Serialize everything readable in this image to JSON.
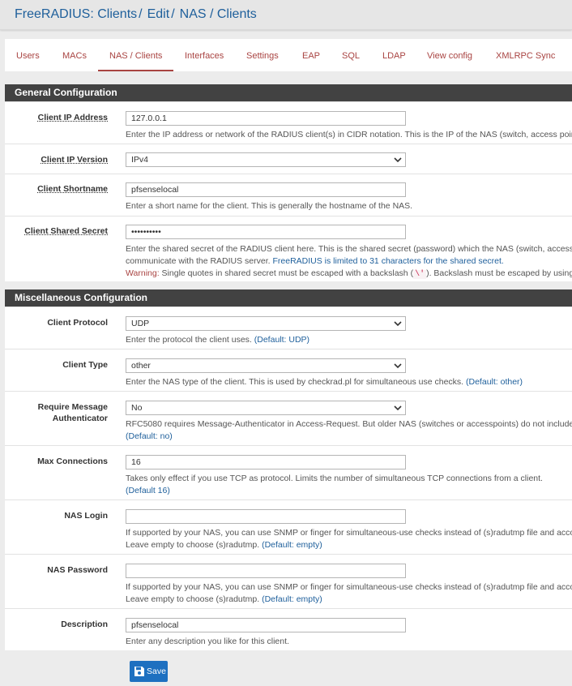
{
  "breadcrumb": {
    "part1": "FreeRADIUS: Clients",
    "part2": "Edit",
    "part3": "NAS / Clients",
    "sep": "/"
  },
  "tabs": [
    {
      "label": "Users"
    },
    {
      "label": "MACs"
    },
    {
      "label": "NAS / Clients",
      "active": true
    },
    {
      "label": "Interfaces"
    },
    {
      "label": "Settings"
    },
    {
      "label": "EAP"
    },
    {
      "label": "SQL"
    },
    {
      "label": "LDAP"
    },
    {
      "label": "View config"
    },
    {
      "label": "XMLRPC Sync"
    }
  ],
  "general": {
    "title": "General Configuration",
    "ip_address": {
      "label": "Client IP Address",
      "value": "127.0.0.1",
      "help": "Enter the IP address or network of the RADIUS client(s) in CIDR notation. This is the IP of the NAS (switch, access point"
    },
    "ip_version": {
      "label": "Client IP Version",
      "value": "IPv4"
    },
    "shortname": {
      "label": "Client Shortname",
      "value": "pfsenselocal",
      "help": "Enter a short name for the client. This is generally the hostname of the NAS."
    },
    "secret": {
      "label": "Client Shared Secret",
      "value": "••••••••••",
      "help1": "Enter the shared secret of the RADIUS client here. This is the shared secret (password) which the NAS (switch, accessp",
      "help2a": "communicate with the RADIUS server. ",
      "help2b": "FreeRADIUS is limited to 31 characters for the shared secret.",
      "warn_label": "Warning:",
      "warn_text": " Single quotes in shared secret must be escaped with a backslash (",
      "warn_code": "\\'",
      "warn_tail": "). Backslash must be escaped by using"
    }
  },
  "misc": {
    "title": "Miscellaneous Configuration",
    "protocol": {
      "label": "Client Protocol",
      "value": "UDP",
      "help": "Enter the protocol the client uses. ",
      "default": "(Default: UDP)"
    },
    "type": {
      "label": "Client Type",
      "value": "other",
      "help": "Enter the NAS type of the client. This is used by checkrad.pl for simultaneous use checks. ",
      "default": "(Default: other)"
    },
    "msg_auth": {
      "label_line1": "Require Message",
      "label_line2": "Authenticator",
      "value": "No",
      "help": "RFC5080 requires Message-Authenticator in Access-Request. But older NAS (switches or accesspoints) do not include",
      "default": "(Default: no)"
    },
    "max_conn": {
      "label": "Max Connections",
      "value": "16",
      "help": "Takes only effect if you use TCP as protocol. Limits the number of simultaneous TCP connections from a client.",
      "default": "(Default 16)"
    },
    "nas_login": {
      "label": "NAS Login",
      "value": "",
      "help1": "If supported by your NAS, you can use SNMP or finger for simultaneous-use checks instead of (s)radutmp file and acco",
      "help2": "Leave empty to choose (s)radutmp. ",
      "default": "(Default: empty)"
    },
    "nas_password": {
      "label": "NAS Password",
      "value": "",
      "help1": "If supported by your NAS, you can use SNMP or finger for simultaneous-use checks instead of (s)radutmp file and acco",
      "help2": "Leave empty to choose (s)radutmp. ",
      "default": "(Default: empty)"
    },
    "description": {
      "label": "Description",
      "value": "pfsenselocal",
      "help": "Enter any description you like for this client."
    }
  },
  "save_label": "Save",
  "colors": {
    "accent": "#1e70c0",
    "link": "#1e5f9b",
    "tab": "#a94442",
    "section_head": "#424242"
  }
}
